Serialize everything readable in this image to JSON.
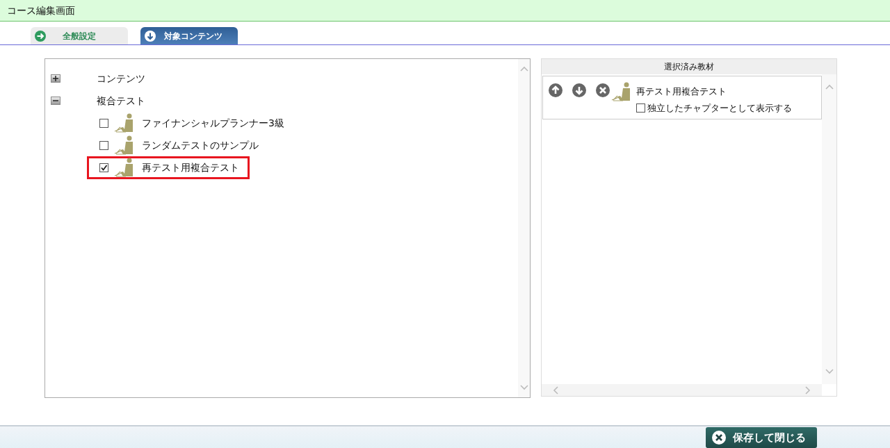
{
  "window": {
    "title": "コース編集画面"
  },
  "tabs": [
    {
      "label": "全般設定",
      "selected": false
    },
    {
      "label": "対象コンテンツ",
      "selected": true
    }
  ],
  "tree": [
    {
      "label": "コンテンツ",
      "expanded": false
    },
    {
      "label": "複合テスト",
      "expanded": true,
      "children": [
        {
          "label": "ファイナンシャルプランナー3級",
          "checked": false,
          "highlighted": false
        },
        {
          "label": "ランダムテストのサンプル",
          "checked": false,
          "highlighted": false
        },
        {
          "label": "再テスト用複合テスト",
          "checked": true,
          "highlighted": true
        }
      ]
    }
  ],
  "selected_panel": {
    "title": "選択済み教材",
    "items": [
      {
        "label": "再テスト用複合テスト",
        "option": {
          "label": "独立したチャプターとして表示する",
          "checked": false
        }
      }
    ]
  },
  "footer": {
    "button": "保存して閉じる"
  }
}
